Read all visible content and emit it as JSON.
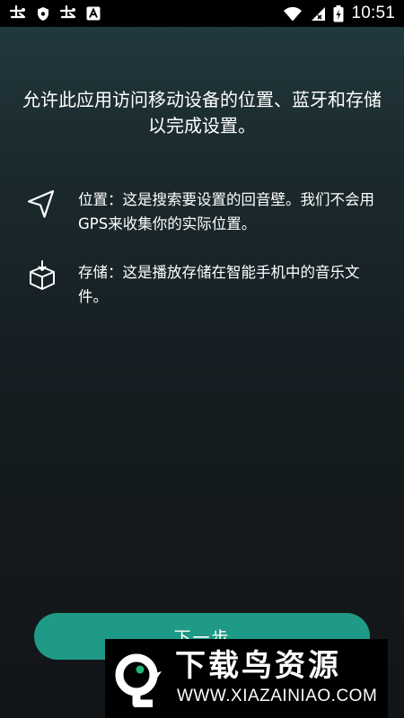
{
  "status_bar": {
    "time": "10:51",
    "left_icons": [
      "app-notification-icon",
      "shield-icon",
      "app-notification-icon",
      "text-a-icon"
    ],
    "right_icons": [
      "wifi-icon",
      "signal-icon",
      "battery-charging-icon"
    ]
  },
  "permission_screen": {
    "heading": "允许此应用访问移动设备的位置、蓝牙和存储以完成设置。",
    "items": [
      {
        "icon": "navigation-arrow-icon",
        "text": "位置：这是搜索要设置的回音壁。我们不会用GPS来收集你的实际位置。"
      },
      {
        "icon": "storage-box-icon",
        "text": "存储：这是播放存储在智能手机中的音乐文件。"
      }
    ],
    "next_button_label": "下一步"
  },
  "watermark": {
    "brand": "下载鸟资源",
    "url": "WWW.XIAZAINIAO.COM"
  },
  "colors": {
    "accent": "#1f9a86",
    "background_top": "#223b40",
    "background_bottom": "#121518",
    "text": "#ffffff"
  }
}
